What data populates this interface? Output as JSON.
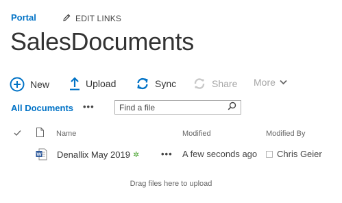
{
  "header": {
    "portal_link": "Portal",
    "edit_links": "EDIT LINKS",
    "title": "SalesDocuments"
  },
  "commands": {
    "new": "New",
    "upload": "Upload",
    "sync": "Sync",
    "share": "Share",
    "more": "More"
  },
  "view": {
    "current": "All Documents",
    "ellipsis": "•••",
    "search_placeholder": "Find a file"
  },
  "columns": {
    "name": "Name",
    "modified": "Modified",
    "modified_by": "Modified By"
  },
  "rows": [
    {
      "name": "Denallix May 2019",
      "new_marker": "✲",
      "ellipsis": "•••",
      "modified": "A few seconds ago",
      "modified_by": "Chris Geier"
    }
  ],
  "footer": {
    "drag_hint": "Drag files here to upload"
  },
  "colors": {
    "accent": "#0072c6",
    "disabled": "#a6a6a6",
    "new_marker": "#44a12a",
    "word_icon": "#2b579a"
  },
  "icons": {
    "edit": "pencil-icon",
    "new": "plus-circle-icon",
    "upload": "upload-arrow-icon",
    "sync": "sync-icon",
    "share": "share-icon",
    "more": "chevron-down-icon",
    "search": "search-icon",
    "file_type": "word-document-icon"
  }
}
